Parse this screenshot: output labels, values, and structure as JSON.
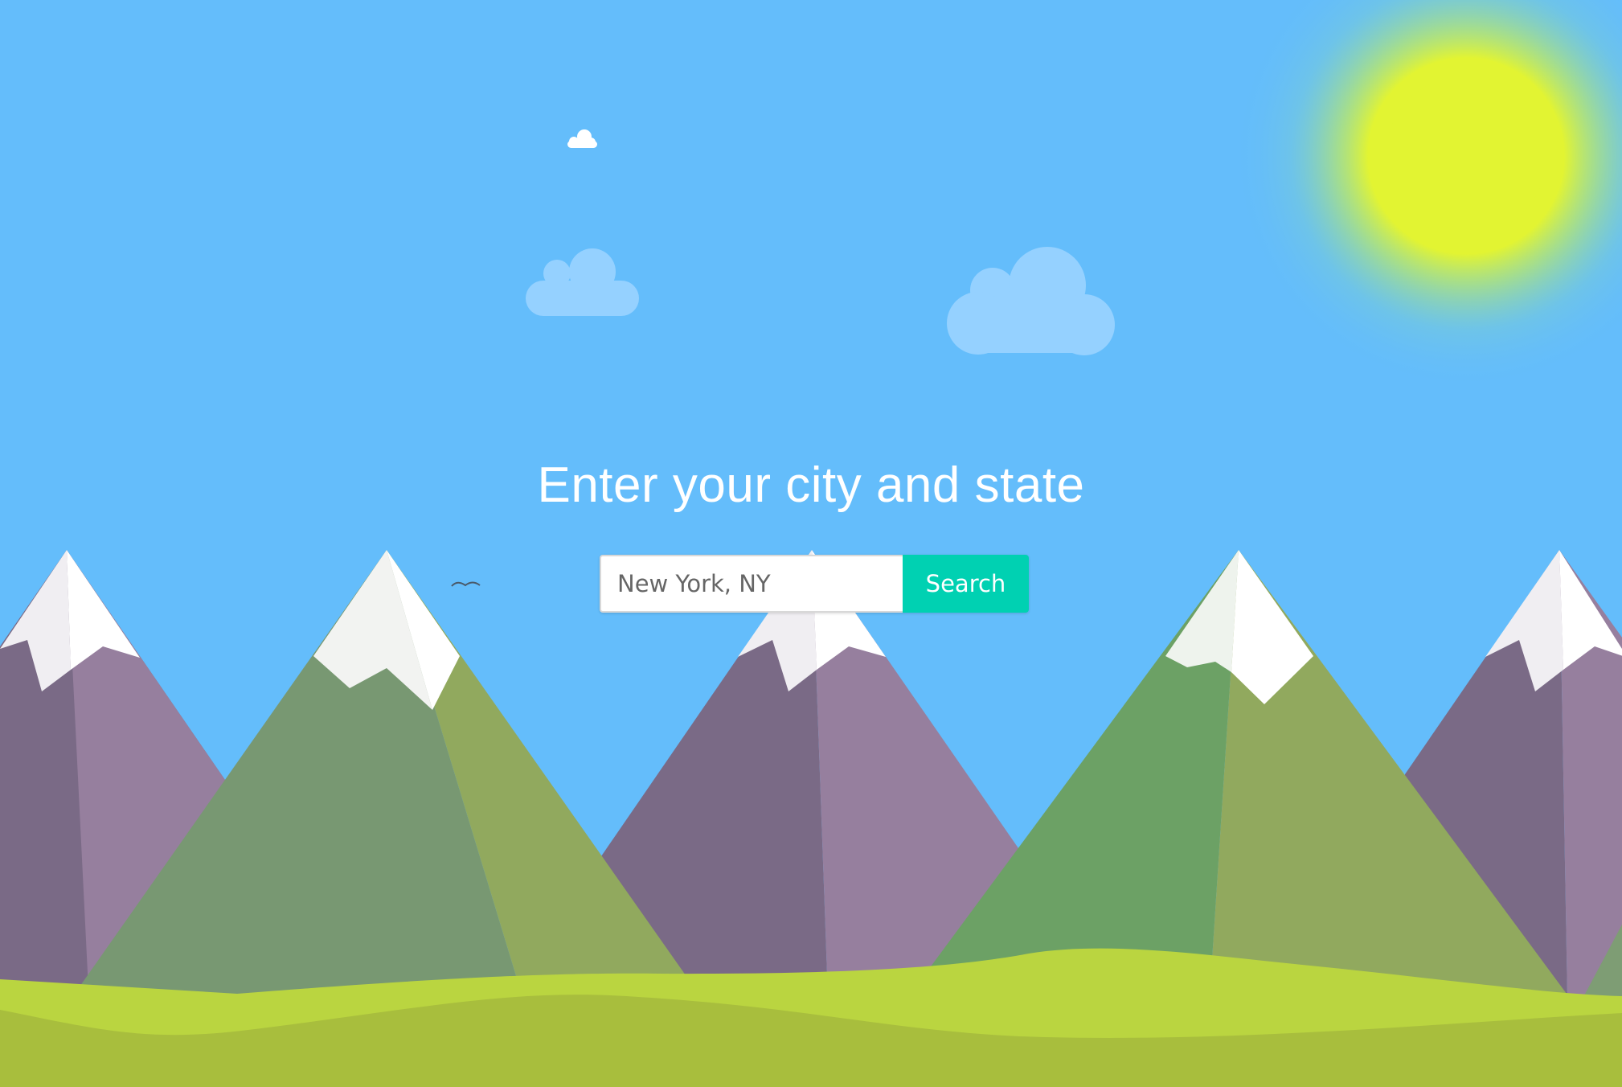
{
  "page": {
    "heading": "Enter your city and state"
  },
  "search": {
    "placeholder": "New York, NY",
    "value": "",
    "button_label": "Search"
  },
  "colors": {
    "sky": "#64bdfb",
    "sun": "#e2f432",
    "accent": "#00d1b2"
  }
}
